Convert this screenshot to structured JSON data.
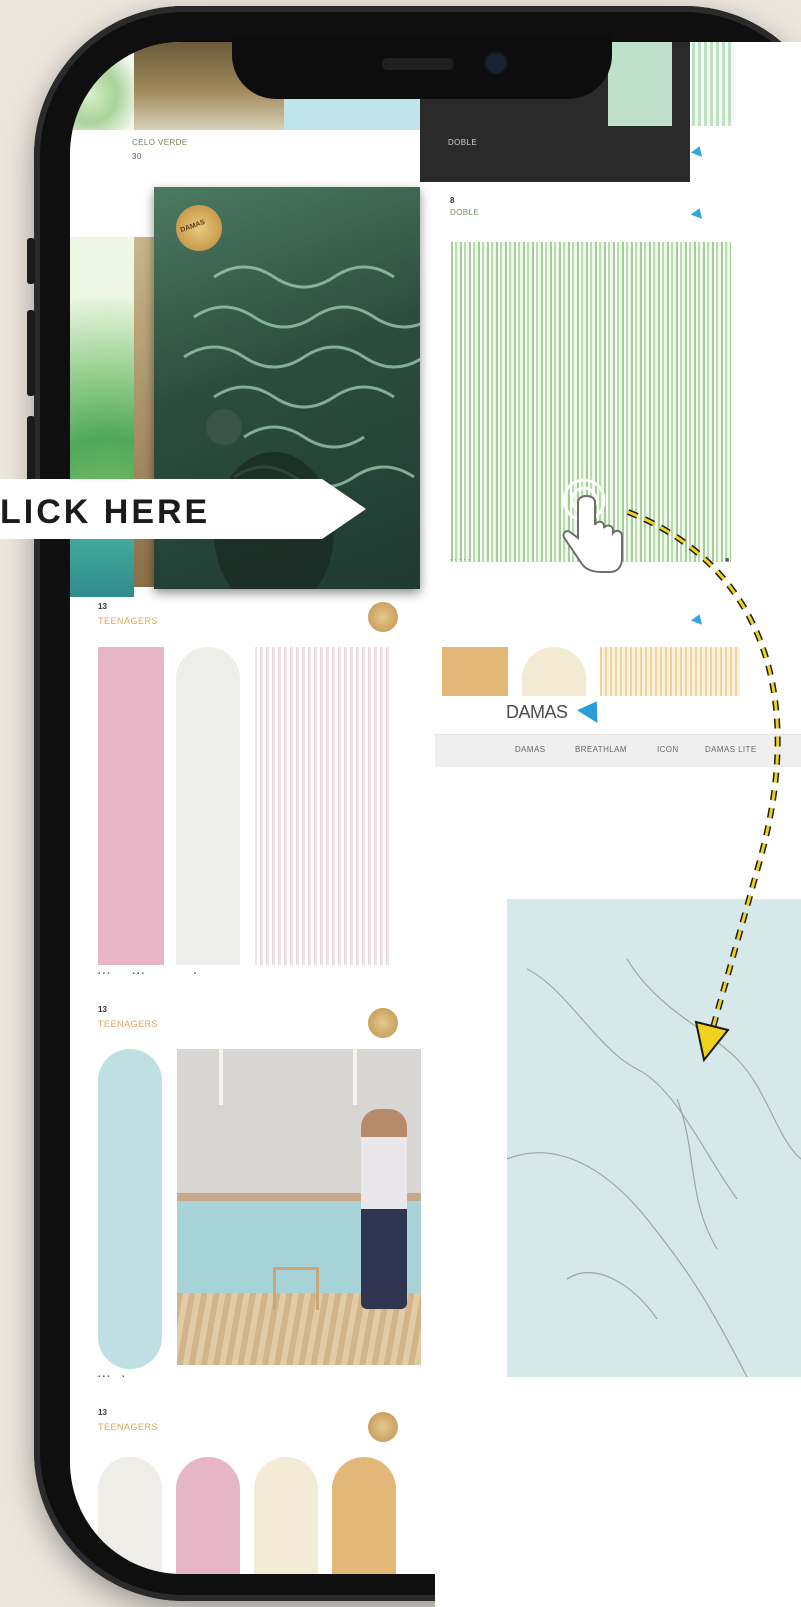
{
  "banner": {
    "label": "LICK HERE"
  },
  "tiles": {
    "top_left_caption": "CELO VERDE",
    "top_left_index": "30",
    "dark_tile_caption": "DOBLE",
    "stripe_tile_index": "8",
    "stripe_tile_caption": "DOBLE",
    "sticker_text": "DAMAS",
    "series_one_index": "13",
    "series_one_label": "TEENAGERS",
    "series_two_index": "13",
    "series_two_label": "TEENAGERS",
    "series_three_index": "13",
    "series_three_label": "TEENAGERS"
  },
  "website": {
    "logo_text": "DAMAS",
    "nav": [
      "DAMAS",
      "BREATHLAM",
      "ICON",
      "DAMAS LITE"
    ]
  },
  "colors": {
    "gold": "#e3a35c",
    "pink": "#e6b6c7",
    "sage": "#a8cf9c",
    "blue": "#bfe0e2",
    "marble": "#d6e8ea"
  }
}
